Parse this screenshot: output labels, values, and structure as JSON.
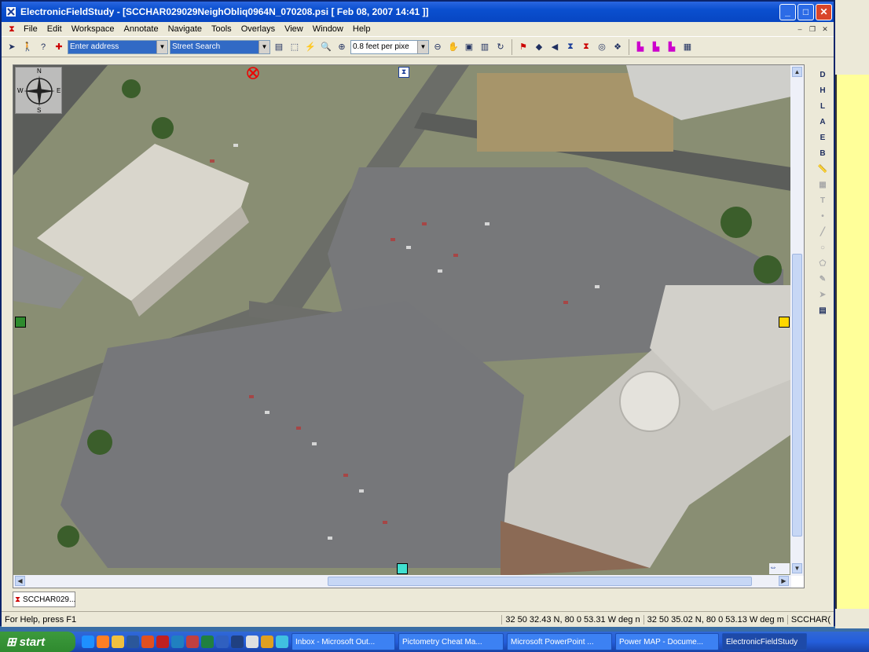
{
  "window": {
    "title": "ElectronicFieldStudy - [SCCHAR029029NeighObliq0964N_070208.psi [ Feb 08, 2007 14:41 ]]"
  },
  "menu": [
    "File",
    "Edit",
    "Workspace",
    "Annotate",
    "Navigate",
    "Tools",
    "Overlays",
    "View",
    "Window",
    "Help"
  ],
  "toolbar": {
    "address_value": "Enter address",
    "street_value": "Street Search",
    "zoom_value": "0.8 feet per pixe"
  },
  "compass": {
    "n": "N",
    "s": "S",
    "e": "E",
    "w": "W"
  },
  "right_tools": [
    "D",
    "H",
    "L",
    "A",
    "E",
    "B",
    "",
    "",
    "T",
    "",
    "",
    "",
    "",
    "",
    ""
  ],
  "doc_tab": "SCCHAR029...",
  "status": {
    "help": "For Help, press F1",
    "coord1": "32 50 32.43 N, 80 0 53.31 W  deg n",
    "coord2": "32 50 35.02 N, 80 0 53.13 W deg m",
    "coord3": "SCCHAR("
  },
  "taskbar": {
    "start": "start",
    "tasks": [
      "Inbox - Microsoft Out...",
      "Pictometry Cheat Ma...",
      "Microsoft PowerPoint ...",
      "Power MAP - Docume...",
      "ElectronicFieldStudy"
    ]
  }
}
